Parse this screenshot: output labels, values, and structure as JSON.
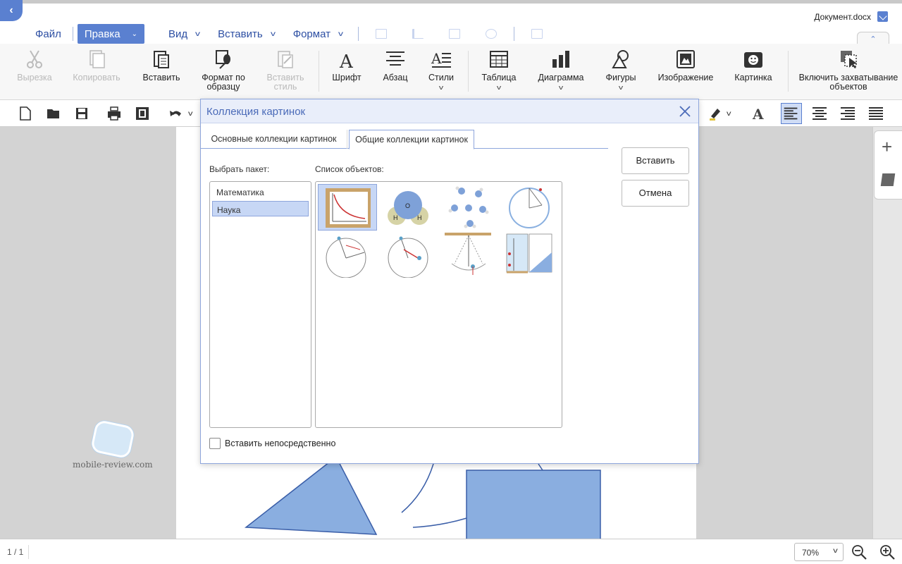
{
  "header": {
    "doc_title": "Документ.docx",
    "menu": {
      "file": "Файл",
      "edit": "Правка",
      "view": "Вид",
      "insert": "Вставить",
      "format": "Формат"
    }
  },
  "ribbon": {
    "cut": "Вырезка",
    "copy": "Копировать",
    "paste": "Вставить",
    "format_painter": "Формат по образцу",
    "paste_style": "Вставить стиль",
    "font": "Шрифт",
    "paragraph": "Абзац",
    "styles": "Стили",
    "table": "Таблица",
    "chart": "Диаграмма",
    "shapes": "Фигуры",
    "image": "Изображение",
    "picture": "Картинка",
    "capture": "Включить захватывание объектов"
  },
  "dialog": {
    "title": "Коллекция картинок",
    "tab_basic": "Основные коллекции картинок",
    "tab_common": "Общие коллекции картинок",
    "select_package_label": "Выбрать пакет:",
    "objects_label": "Список объектов:",
    "packages": [
      "Математика",
      "Наука"
    ],
    "selected_package": "Наука",
    "insert_button": "Вставить",
    "cancel_button": "Отмена",
    "insert_directly": "Вставить непосредственно",
    "molecule_labels": {
      "o": "O",
      "h1": "H",
      "h2": "H"
    }
  },
  "status": {
    "pages": "1 / 1",
    "zoom": "70%"
  },
  "watermark": "mobile-review.com",
  "colors": {
    "accent": "#5a80d0",
    "menu_text": "#2d4fa3",
    "selection": "#c7d7f5",
    "shape_fill": "#8aaee0"
  }
}
